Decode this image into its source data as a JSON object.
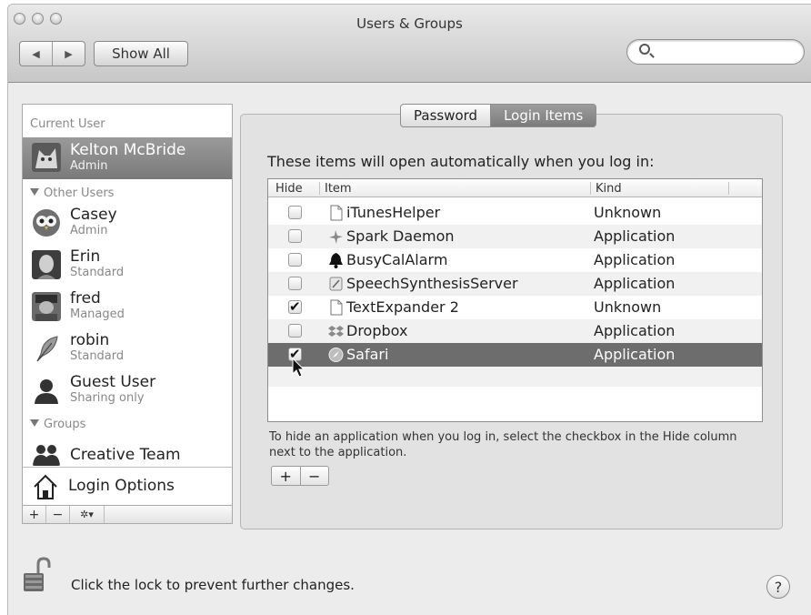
{
  "window": {
    "title": "Users & Groups"
  },
  "toolbar": {
    "back_glyph": "◀",
    "forward_glyph": "▶",
    "show_all_label": "Show All",
    "search_value": ""
  },
  "sidebar": {
    "current_user_header": "Current User",
    "current_user": {
      "name": "Kelton McBride",
      "role": "Admin"
    },
    "other_users_header": "Other Users",
    "other_users": [
      {
        "name": "Casey",
        "role": "Admin",
        "icon": "owl-avatar-icon"
      },
      {
        "name": "Erin",
        "role": "Standard",
        "icon": "photo-avatar-icon"
      },
      {
        "name": "fred",
        "role": "Managed",
        "icon": "photo-avatar-icon"
      },
      {
        "name": "robin",
        "role": "Standard",
        "icon": "feather-avatar-icon"
      },
      {
        "name": "Guest User",
        "role": "Sharing only",
        "icon": "person-silhouette-icon"
      }
    ],
    "groups_header": "Groups",
    "groups": [
      {
        "name": "Creative Team",
        "icon": "group-icon"
      }
    ],
    "login_options_label": "Login Options",
    "bottom_toolbar": {
      "add": "+",
      "remove": "−",
      "action": "✲▾"
    }
  },
  "tabs": {
    "password": "Password",
    "login_items": "Login Items",
    "active": "Login Items"
  },
  "login_items": {
    "intro": "These items will open automatically when you log in:",
    "columns": {
      "hide": "Hide",
      "item": "Item",
      "kind": "Kind"
    },
    "rows": [
      {
        "hide": false,
        "name": "iTunesHelper",
        "kind": "Unknown",
        "icon": "document-icon"
      },
      {
        "hide": false,
        "name": "Spark Daemon",
        "kind": "Application",
        "icon": "spark-icon"
      },
      {
        "hide": false,
        "name": "BusyCalAlarm",
        "kind": "Application",
        "icon": "bell-icon"
      },
      {
        "hide": false,
        "name": "SpeechSynthesisServer",
        "kind": "Application",
        "icon": "app-icon"
      },
      {
        "hide": true,
        "name": "TextExpander 2",
        "kind": "Unknown",
        "icon": "document-icon"
      },
      {
        "hide": false,
        "name": "Dropbox",
        "kind": "Application",
        "icon": "dropbox-icon"
      },
      {
        "hide": true,
        "name": "Safari",
        "kind": "Application",
        "icon": "safari-icon",
        "selected": true
      }
    ],
    "hint": "To hide an application when you log in, select the checkbox in the Hide column next to the application.",
    "add": "+",
    "remove": "−"
  },
  "footer": {
    "lock_text": "Click the lock to prevent further changes.",
    "help": "?"
  }
}
